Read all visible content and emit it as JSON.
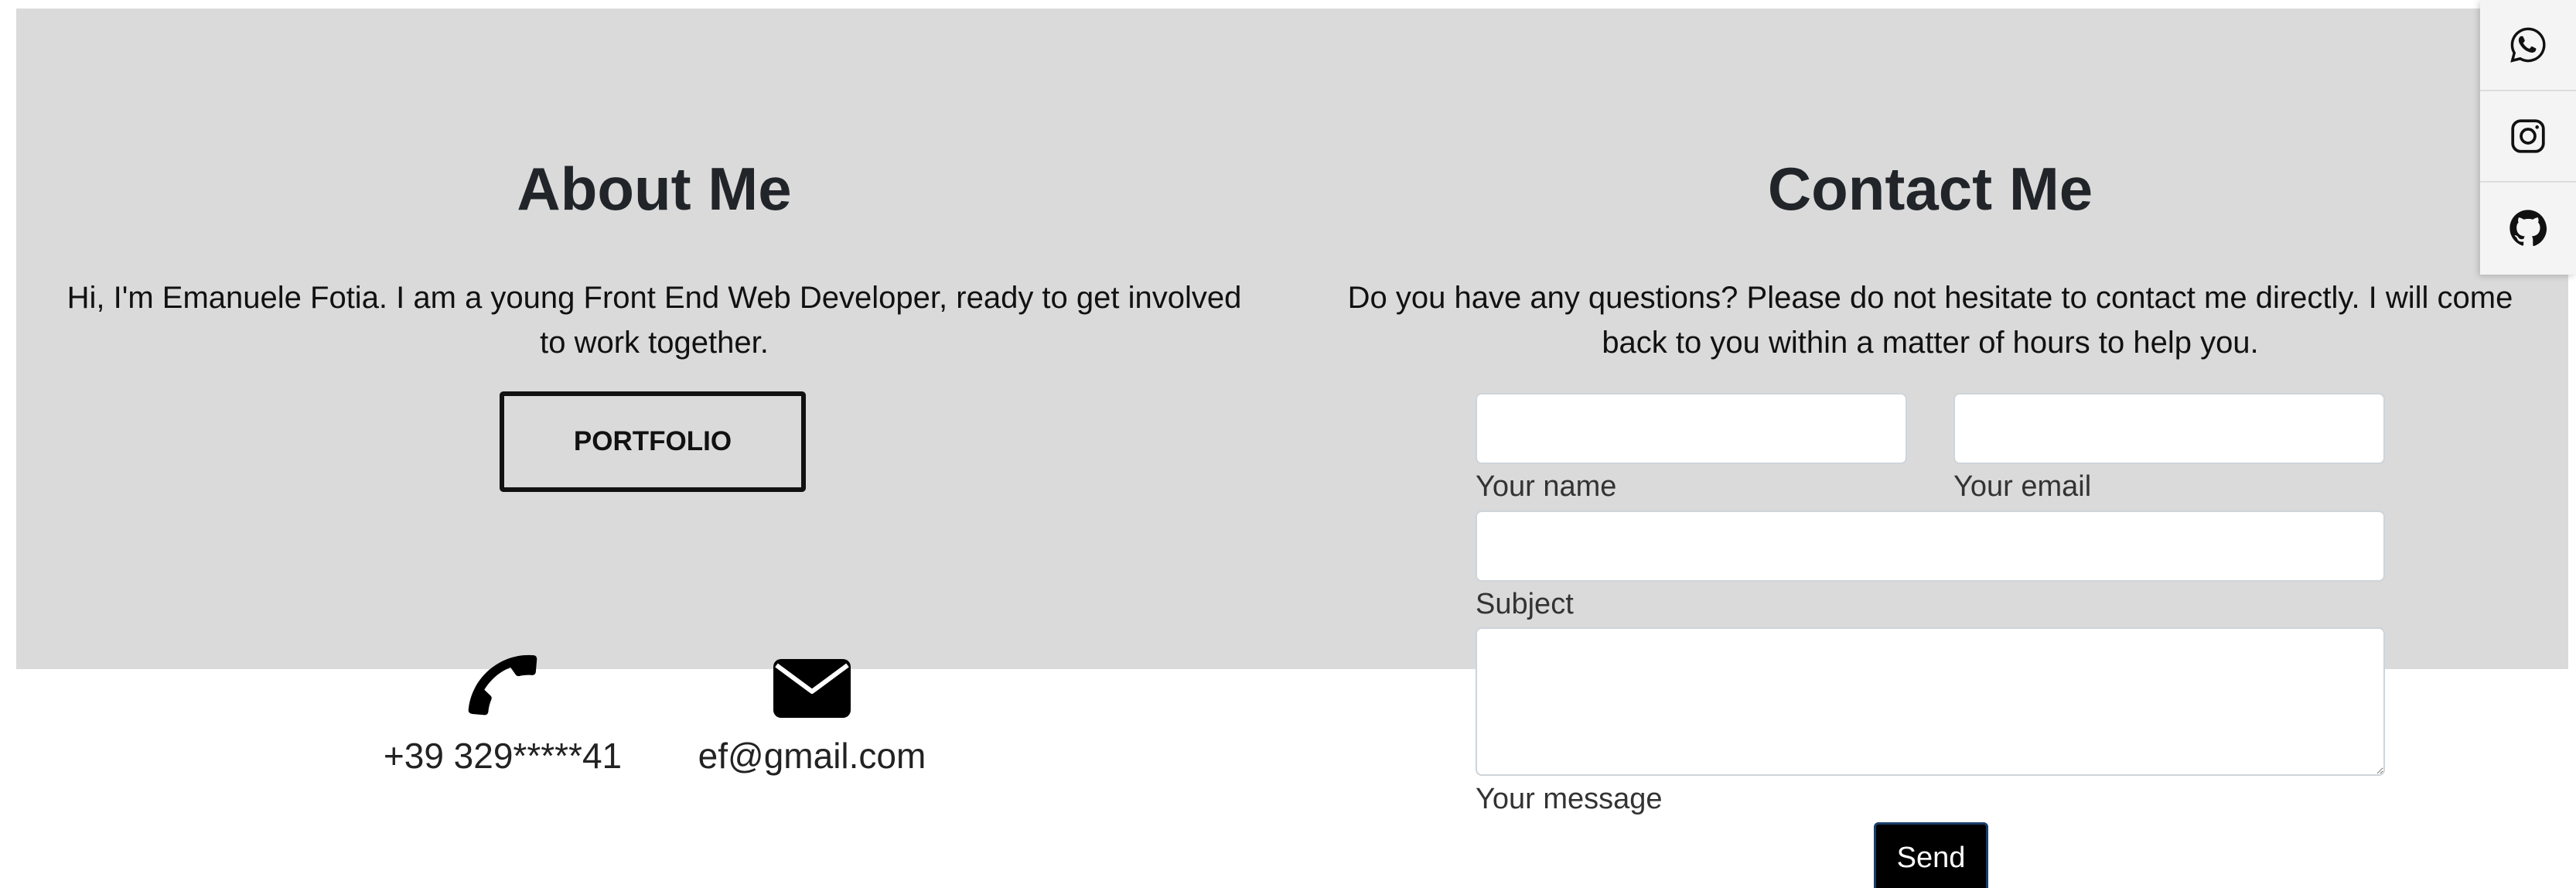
{
  "about": {
    "title": "About Me",
    "text": "Hi, I'm Emanuele Fotia. I am a young Front End Web Developer, ready to get involved to work together.",
    "button_label": "PORTFOLIO"
  },
  "contact_info": {
    "phone": "+39 329*****41",
    "email": "ef@gmail.com",
    "phone_icon": "phone-icon",
    "email_icon": "envelope-icon"
  },
  "contact": {
    "title": "Contact Me",
    "text": "Do you have any questions? Please do not hesitate to contact me directly. I will come back to you within a matter of hours to help you.",
    "fields": {
      "name_label": "Your name",
      "email_label": "Your email",
      "subject_label": "Subject",
      "message_label": "Your message"
    },
    "send_label": "Send"
  },
  "social": [
    {
      "icon": "whatsapp-icon"
    },
    {
      "icon": "instagram-icon"
    },
    {
      "icon": "github-icon"
    }
  ],
  "colors": {
    "band": "#dadada",
    "button_dark": "#000000"
  }
}
